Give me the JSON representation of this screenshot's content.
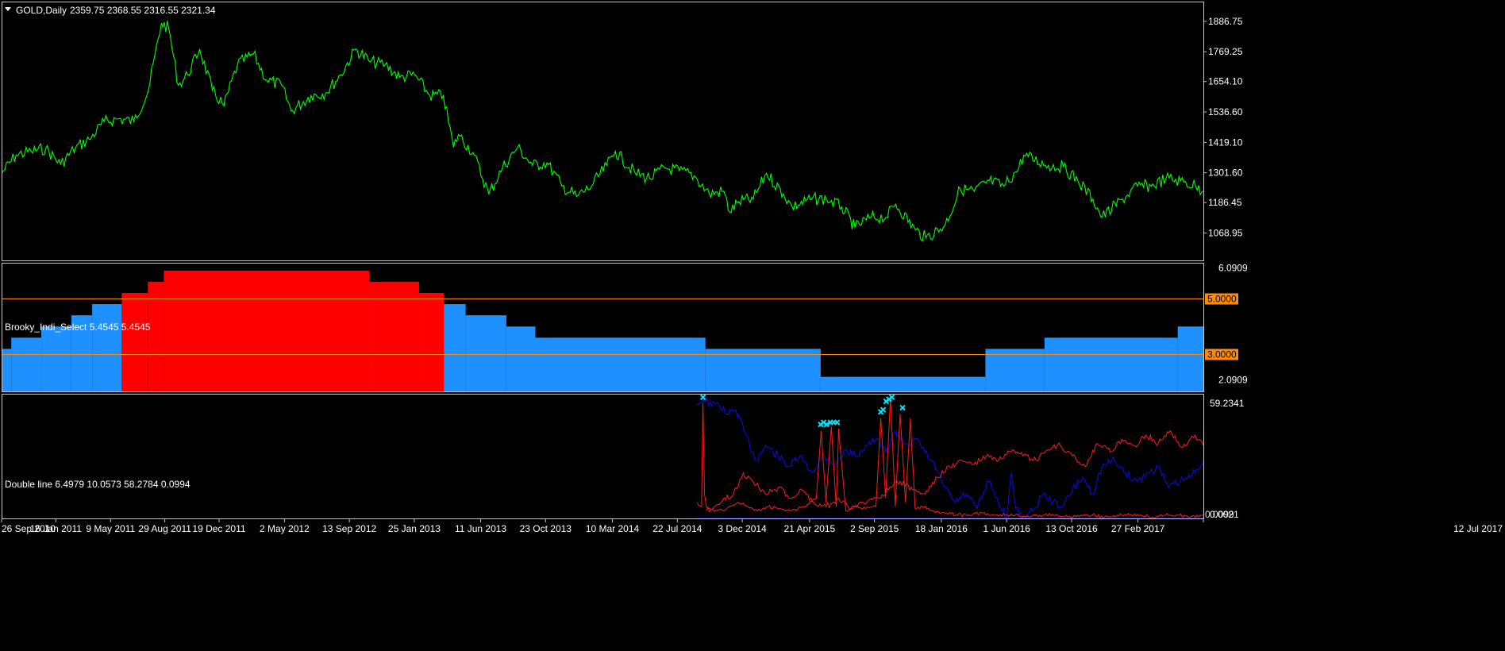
{
  "colors": {
    "background": "#000000",
    "frame": "#c8c8c8",
    "price_line": "#00ff00",
    "bull_bar": "#1e90ff",
    "bear_bar": "#ff0000",
    "level_line": "#ff8c00",
    "line_blue": "#0a0af0",
    "line_red": "#ff1a1a",
    "marker": "#00e5ff",
    "text": "#ffffff"
  },
  "chart_data": [
    {
      "pane": "price",
      "type": "line",
      "title": "GOLD,Daily",
      "ohlc": "2359.75 2368.55 2316.55 2321.34",
      "yticks": [
        "1886.75",
        "1769.25",
        "1654.10",
        "1536.60",
        "1419.10",
        "1301.60",
        "1186.45",
        "1068.95"
      ],
      "ylim": [
        960,
        1960
      ],
      "series": [
        {
          "color": "#00ff00",
          "x": [
            "2010-09-26",
            "2010-10-26",
            "2010-11-26",
            "2010-12-26",
            "2011-01-26",
            "2011-02-26",
            "2011-03-26",
            "2011-04-26",
            "2011-05-26",
            "2011-06-26",
            "2011-07-26",
            "2011-08-22",
            "2011-09-06",
            "2011-09-26",
            "2011-10-15",
            "2011-11-09",
            "2011-12-05",
            "2011-12-29",
            "2012-01-26",
            "2012-02-28",
            "2012-03-26",
            "2012-04-26",
            "2012-05-16",
            "2012-06-26",
            "2012-07-26",
            "2012-08-26",
            "2012-09-26",
            "2012-10-26",
            "2012-11-26",
            "2012-12-26",
            "2013-01-26",
            "2013-02-26",
            "2013-03-26",
            "2013-04-16",
            "2013-04-26",
            "2013-05-26",
            "2013-06-28",
            "2013-07-26",
            "2013-08-26",
            "2013-09-26",
            "2013-10-26",
            "2013-11-26",
            "2013-12-26",
            "2014-01-26",
            "2014-02-26",
            "2014-03-16",
            "2014-04-26",
            "2014-05-26",
            "2014-06-26",
            "2014-07-26",
            "2014-08-26",
            "2014-09-26",
            "2014-10-26",
            "2014-11-07",
            "2014-11-26",
            "2014-12-26",
            "2015-01-22",
            "2015-02-26",
            "2015-03-16",
            "2015-04-26",
            "2015-05-26",
            "2015-06-26",
            "2015-07-24",
            "2015-08-26",
            "2015-09-26",
            "2015-10-16",
            "2015-11-26",
            "2015-12-17",
            "2016-01-26",
            "2016-02-26",
            "2016-03-26",
            "2016-04-26",
            "2016-05-26",
            "2016-06-26",
            "2016-07-06",
            "2016-08-26",
            "2016-09-26",
            "2016-10-26",
            "2016-11-26",
            "2016-12-15",
            "2017-01-26",
            "2017-02-26",
            "2017-03-26",
            "2017-04-26",
            "2017-05-26",
            "2017-06-26",
            "2017-07-12"
          ],
          "y": [
            1300,
            1370,
            1385,
            1395,
            1335,
            1400,
            1430,
            1500,
            1510,
            1500,
            1620,
            1880,
            1860,
            1640,
            1680,
            1780,
            1620,
            1560,
            1720,
            1760,
            1660,
            1640,
            1540,
            1600,
            1610,
            1680,
            1780,
            1730,
            1720,
            1670,
            1680,
            1600,
            1600,
            1400,
            1450,
            1380,
            1220,
            1320,
            1400,
            1330,
            1340,
            1250,
            1210,
            1250,
            1330,
            1385,
            1300,
            1280,
            1320,
            1310,
            1290,
            1220,
            1230,
            1150,
            1190,
            1200,
            1300,
            1220,
            1170,
            1200,
            1200,
            1170,
            1090,
            1130,
            1130,
            1180,
            1080,
            1050,
            1100,
            1240,
            1230,
            1270,
            1250,
            1320,
            1370,
            1330,
            1325,
            1270,
            1200,
            1130,
            1200,
            1250,
            1250,
            1280,
            1270,
            1250,
            1230
          ]
        }
      ]
    },
    {
      "pane": "indicator",
      "type": "bar",
      "title": "Brooky_Indi_Select 5.4545 5.4545",
      "yticks": [
        "6.0909",
        "2.0909"
      ],
      "ylim": [
        1.65,
        6.25
      ],
      "levels": [
        {
          "value": 5.0,
          "label": "5.0000"
        },
        {
          "value": 3.0,
          "label": "3.0000"
        }
      ],
      "bars": [
        {
          "start": "2010-09-26",
          "end": "2010-10-16",
          "value": 3.2,
          "color": "#1e90ff"
        },
        {
          "start": "2010-10-16",
          "end": "2010-12-17",
          "value": 3.6,
          "color": "#1e90ff"
        },
        {
          "start": "2010-12-17",
          "end": "2011-02-17",
          "value": 4.0,
          "color": "#1e90ff"
        },
        {
          "start": "2011-02-17",
          "end": "2011-04-01",
          "value": 4.4,
          "color": "#1e90ff"
        },
        {
          "start": "2011-04-01",
          "end": "2011-06-01",
          "value": 4.8,
          "color": "#1e90ff"
        },
        {
          "start": "2011-06-01",
          "end": "2011-07-25",
          "value": 5.2,
          "color": "#ff0000"
        },
        {
          "start": "2011-07-25",
          "end": "2011-08-27",
          "value": 5.6,
          "color": "#ff0000"
        },
        {
          "start": "2011-08-27",
          "end": "2012-10-24",
          "value": 6.0,
          "color": "#ff0000"
        },
        {
          "start": "2012-10-24",
          "end": "2013-02-04",
          "value": 5.6,
          "color": "#ff0000"
        },
        {
          "start": "2013-02-04",
          "end": "2013-03-27",
          "value": 5.2,
          "color": "#ff0000"
        },
        {
          "start": "2013-03-27",
          "end": "2013-05-11",
          "value": 4.8,
          "color": "#1e90ff"
        },
        {
          "start": "2013-05-11",
          "end": "2013-08-03",
          "value": 4.4,
          "color": "#1e90ff"
        },
        {
          "start": "2013-08-03",
          "end": "2013-10-02",
          "value": 4.0,
          "color": "#1e90ff"
        },
        {
          "start": "2013-10-02",
          "end": "2014-09-18",
          "value": 3.6,
          "color": "#1e90ff"
        },
        {
          "start": "2014-09-18",
          "end": "2015-05-14",
          "value": 3.2,
          "color": "#1e90ff"
        },
        {
          "start": "2015-05-14",
          "end": "2016-04-18",
          "value": 2.2,
          "color": "#1e90ff"
        },
        {
          "start": "2016-04-18",
          "end": "2016-08-18",
          "value": 3.2,
          "color": "#1e90ff"
        },
        {
          "start": "2016-08-18",
          "end": "2017-05-20",
          "value": 3.6,
          "color": "#1e90ff"
        },
        {
          "start": "2017-05-20",
          "end": "2017-07-12",
          "value": 4.0,
          "color": "#1e90ff"
        }
      ]
    },
    {
      "pane": "double_line",
      "type": "line",
      "title": "Double line 6.4979 10.0573 58.2784 0.0994",
      "yticks": [
        "59.2341",
        "0.0021"
      ],
      "extra_labels": [
        "0.0099"
      ],
      "ylim": [
        0,
        59.2341
      ],
      "series": [
        {
          "color": "#0a0af0",
          "x": [
            "2014-09-01",
            "2014-09-15",
            "2014-10-01",
            "2014-10-15",
            "2014-11-01",
            "2014-11-20",
            "2014-12-10",
            "2015-01-01",
            "2015-01-20",
            "2015-02-15",
            "2015-03-10",
            "2015-04-01",
            "2015-04-25",
            "2015-05-20",
            "2015-06-15",
            "2015-07-05",
            "2015-07-25",
            "2015-08-15",
            "2015-09-05",
            "2015-09-25",
            "2015-10-15",
            "2015-11-05",
            "2015-11-25",
            "2015-12-15",
            "2016-01-05",
            "2016-01-25",
            "2016-02-15",
            "2016-03-10",
            "2016-04-01",
            "2016-04-25",
            "2016-05-15",
            "2016-06-01",
            "2016-06-10",
            "2016-06-20",
            "2016-07-05",
            "2016-07-25",
            "2016-08-15",
            "2016-09-05",
            "2016-09-25",
            "2016-10-15",
            "2016-11-05",
            "2016-11-25",
            "2016-12-15",
            "2017-01-10",
            "2017-02-01",
            "2017-02-25",
            "2017-03-20",
            "2017-04-10",
            "2017-05-01",
            "2017-05-25",
            "2017-06-15",
            "2017-07-12"
          ],
          "y": [
            55,
            57,
            54,
            55,
            50,
            52,
            40,
            28,
            35,
            30,
            25,
            30,
            22,
            30,
            26,
            33,
            30,
            35,
            38,
            32,
            42,
            36,
            38,
            32,
            25,
            15,
            8,
            12,
            5,
            18,
            8,
            1,
            22,
            5,
            1,
            4,
            12,
            8,
            6,
            14,
            20,
            12,
            25,
            28,
            22,
            18,
            22,
            25,
            15,
            18,
            20,
            28
          ]
        },
        {
          "color": "#ff1a1a",
          "x": [
            "2014-09-01",
            "2014-09-10",
            "2014-09-13",
            "2014-09-16",
            "2014-09-20",
            "2014-10-10",
            "2014-11-01",
            "2014-11-25",
            "2014-12-15",
            "2015-01-10",
            "2015-01-25",
            "2015-02-20",
            "2015-03-15",
            "2015-04-10",
            "2015-05-05",
            "2015-05-15",
            "2015-05-25",
            "2015-06-05",
            "2015-06-15",
            "2015-06-20",
            "2015-07-05",
            "2015-07-25",
            "2015-08-15",
            "2015-09-05",
            "2015-09-15",
            "2015-09-25",
            "2015-10-05",
            "2015-10-15",
            "2015-10-25",
            "2015-11-05",
            "2015-11-15",
            "2015-11-25",
            "2015-12-10",
            "2016-01-01",
            "2016-01-25",
            "2016-02-20",
            "2016-03-15",
            "2016-04-10",
            "2016-05-05",
            "2016-06-01",
            "2016-06-25",
            "2016-07-20",
            "2016-08-15",
            "2016-09-10",
            "2016-10-05",
            "2016-11-01",
            "2016-11-25",
            "2016-12-20",
            "2017-01-15",
            "2017-02-10",
            "2017-03-05",
            "2017-03-30",
            "2017-04-25",
            "2017-05-20",
            "2017-06-15",
            "2017-07-12"
          ],
          "y": [
            8,
            6,
            55,
            12,
            6,
            4,
            5,
            8,
            6,
            4,
            6,
            5,
            4,
            6,
            10,
            42,
            8,
            44,
            6,
            43,
            4,
            6,
            5,
            6,
            48,
            10,
            58,
            6,
            50,
            8,
            48,
            5,
            6,
            4,
            3,
            2,
            2,
            3,
            2,
            2,
            2,
            1,
            2,
            2,
            1,
            2,
            2,
            1,
            2,
            2,
            2,
            1,
            2,
            2,
            1,
            2
          ]
        },
        {
          "color": "#ff1a1a",
          "x": [
            "2014-09-20",
            "2014-10-20",
            "2014-11-15",
            "2014-12-05",
            "2014-12-25",
            "2015-01-20",
            "2015-02-15",
            "2015-03-15",
            "2015-04-05",
            "2015-04-30",
            "2015-05-25",
            "2015-06-20",
            "2015-07-15",
            "2015-08-10",
            "2015-09-05",
            "2015-10-01",
            "2015-10-25",
            "2015-11-20",
            "2015-12-15",
            "2016-01-10",
            "2016-02-05",
            "2016-03-01",
            "2016-03-25",
            "2016-04-20",
            "2016-05-15",
            "2016-06-10",
            "2016-07-05",
            "2016-08-01",
            "2016-08-25",
            "2016-09-20",
            "2016-10-15",
            "2016-11-10",
            "2016-12-05",
            "2017-01-01",
            "2017-01-25",
            "2017-02-20",
            "2017-03-15",
            "2017-04-10",
            "2017-05-05",
            "2017-05-30",
            "2017-06-25",
            "2017-07-12"
          ],
          "y": [
            4,
            8,
            12,
            22,
            18,
            12,
            15,
            10,
            14,
            8,
            6,
            10,
            5,
            8,
            10,
            14,
            18,
            14,
            12,
            20,
            25,
            28,
            26,
            30,
            28,
            32,
            30,
            28,
            33,
            35,
            30,
            25,
            36,
            32,
            38,
            35,
            40,
            36,
            42,
            34,
            40,
            35
          ]
        }
      ],
      "markers": {
        "color": "#00e5ff",
        "x": [
          "2014-09-13",
          "2015-05-14",
          "2015-05-20",
          "2015-05-26",
          "2015-06-03",
          "2015-06-10",
          "2015-06-17",
          "2015-09-15",
          "2015-09-20",
          "2015-09-26",
          "2015-10-02",
          "2015-10-08",
          "2015-10-30"
        ],
        "y": [
          58,
          45,
          46,
          45,
          46,
          46,
          46,
          51,
          52,
          56,
          57,
          58,
          53
        ]
      }
    }
  ],
  "xaxis": {
    "labels": [
      "26 Sep 2010",
      "16 Jan 2011",
      "9 May 2011",
      "29 Aug 2011",
      "19 Dec 2011",
      "2 May 2012",
      "13 Sep 2012",
      "25 Jan 2013",
      "11 Jun 2013",
      "23 Oct 2013",
      "10 Mar 2014",
      "22 Jul 2014",
      "3 Dec 2014",
      "21 Apr 2015",
      "2 Sep 2015",
      "18 Jan 2016",
      "1 Jun 2016",
      "13 Oct 2016",
      "27 Feb 2017",
      "12 Jul 2017"
    ],
    "dates": [
      "2010-09-26",
      "2011-01-16",
      "2011-05-09",
      "2011-08-29",
      "2011-12-19",
      "2012-05-02",
      "2012-09-13",
      "2013-01-25",
      "2013-06-11",
      "2013-10-23",
      "2014-03-10",
      "2014-07-22",
      "2014-12-03",
      "2015-04-21",
      "2015-09-02",
      "2016-01-18",
      "2016-06-01",
      "2016-10-13",
      "2017-02-27",
      "2017-07-12"
    ]
  }
}
